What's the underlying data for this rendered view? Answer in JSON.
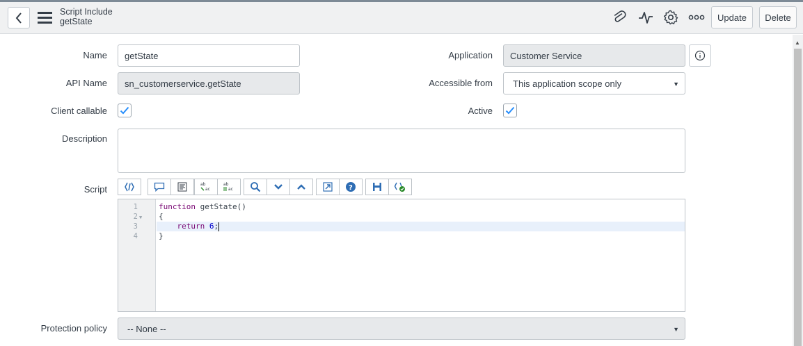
{
  "header": {
    "title": "Script Include",
    "subtitle": "getState",
    "update_label": "Update",
    "delete_label": "Delete"
  },
  "form": {
    "name_label": "Name",
    "name_value": "getState",
    "api_name_label": "API Name",
    "api_name_value": "sn_customerservice.getState",
    "client_callable_label": "Client callable",
    "client_callable_checked": true,
    "description_label": "Description",
    "description_value": "",
    "script_label": "Script",
    "application_label": "Application",
    "application_value": "Customer Service",
    "accessible_from_label": "Accessible from",
    "accessible_from_value": "This application scope only",
    "active_label": "Active",
    "active_checked": true,
    "protection_policy_label": "Protection policy",
    "protection_policy_value": "-- None --"
  },
  "editor": {
    "line_numbers": [
      "1",
      "2",
      "3",
      "4"
    ],
    "lines": {
      "l1_keyword": "function",
      "l1_rest": " getState()",
      "l2": "{",
      "l3_indent": "    ",
      "l3_keyword": "return",
      "l3_space": " ",
      "l3_number": "6",
      "l3_semicolon": ";",
      "l4": "}"
    }
  },
  "colors": {
    "accent_blue": "#278efc",
    "checkbox_check": "#278efc",
    "toolbar_icon_blue": "#2e6db4"
  },
  "icons": {
    "back": "chevron-left-icon",
    "menu": "hamburger-menu-icon",
    "attachment": "paperclip-icon",
    "activity": "pulse-icon",
    "settings": "gear-icon",
    "more": "more-options-icon",
    "info": "info-icon"
  }
}
